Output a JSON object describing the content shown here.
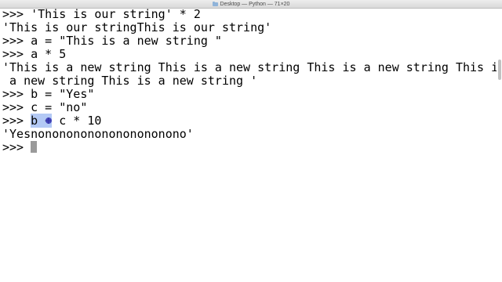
{
  "window": {
    "title": "Desktop — Python — 71×20",
    "folder_icon": "folder-icon"
  },
  "terminal": {
    "lines": [
      ">>> 'This is our string' * 2",
      "'This is our stringThis is our string'",
      ">>> a = \"This is a new string \"",
      ">>> a * 5",
      "'This is a new string This is a new string This is a new string This is",
      " a new string This is a new string '",
      ">>> b = \"Yes\"",
      ">>> c = \"no\""
    ],
    "selected_line": {
      "prompt": ">>> ",
      "selected_text": "b +",
      "rest": " c * 10"
    },
    "result_line": "'Yesnonononononononononono'",
    "current_prompt": ">>> "
  },
  "colors": {
    "selection": "#b3c9f5",
    "cursor": "#9a9a9a",
    "text": "#000000"
  }
}
